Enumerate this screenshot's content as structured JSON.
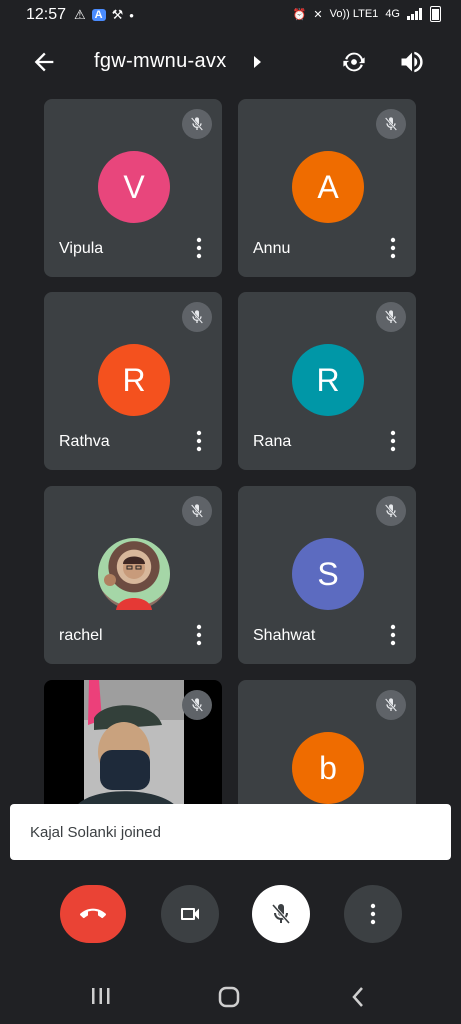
{
  "status_bar": {
    "time": "12:57",
    "network": "Vo)) LTE1",
    "signal_label": "4G"
  },
  "header": {
    "meeting_code": "fgw-mwnu-avx"
  },
  "participants": [
    {
      "name": "Vipula",
      "initial": "V",
      "color": "#e8467c"
    },
    {
      "name": "Annu",
      "initial": "A",
      "color": "#ef6c00"
    },
    {
      "name": "Rathva",
      "initial": "R",
      "color": "#f4511e"
    },
    {
      "name": "Rana",
      "initial": "R",
      "color": "#0097a7"
    },
    {
      "name": "rachel",
      "initial": "",
      "color": "#a1887f"
    },
    {
      "name": "Shahwat",
      "initial": "S",
      "color": "#5c6bc0"
    },
    {
      "name": "",
      "initial": "",
      "color": "#000000"
    },
    {
      "name": "",
      "initial": "b",
      "color": "#ef6c00"
    }
  ],
  "toast": {
    "message": "Kajal Solanki joined"
  },
  "controls": {
    "end_call_color": "#ea4335",
    "icons": [
      "end-call-icon",
      "camera-icon",
      "mic-off-icon",
      "more-vert-icon"
    ]
  },
  "nav": {
    "icons": [
      "recents-icon",
      "home-icon",
      "back-icon"
    ]
  }
}
